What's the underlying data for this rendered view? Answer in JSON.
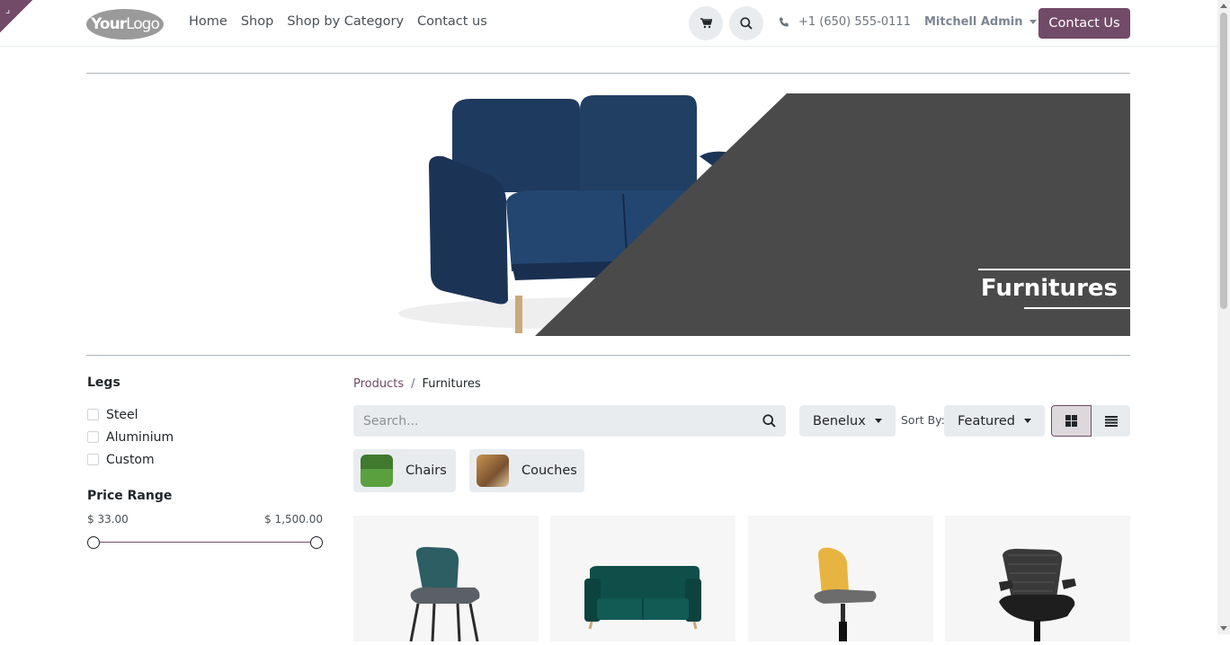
{
  "header": {
    "logo_text_bold": "Your",
    "logo_text_light": "Logo",
    "nav": [
      "Home",
      "Shop",
      "Shop by Category",
      "Contact us"
    ],
    "phone": "+1 (650) 555-0111",
    "user": "Mitchell Admin",
    "contact_button": "Contact Us"
  },
  "banner": {
    "title": "Furnitures"
  },
  "filters": {
    "legs_title": "Legs",
    "legs_options": [
      "Steel",
      "Aluminium",
      "Custom"
    ],
    "price_title": "Price Range",
    "price_min": "$ 33.00",
    "price_max": "$ 1,500.00"
  },
  "breadcrumb": {
    "parent": "Products",
    "separator": "/",
    "current": "Furnitures"
  },
  "toolbar": {
    "search_placeholder": "Search...",
    "pricelist": "Benelux",
    "sort_label": "Sort By:",
    "sort_value": "Featured"
  },
  "categories": [
    "Chairs",
    "Couches"
  ],
  "colors": {
    "brand": "#714B67",
    "banner_dark": "#4a4a4a",
    "sofa": "#1f3a5f"
  }
}
